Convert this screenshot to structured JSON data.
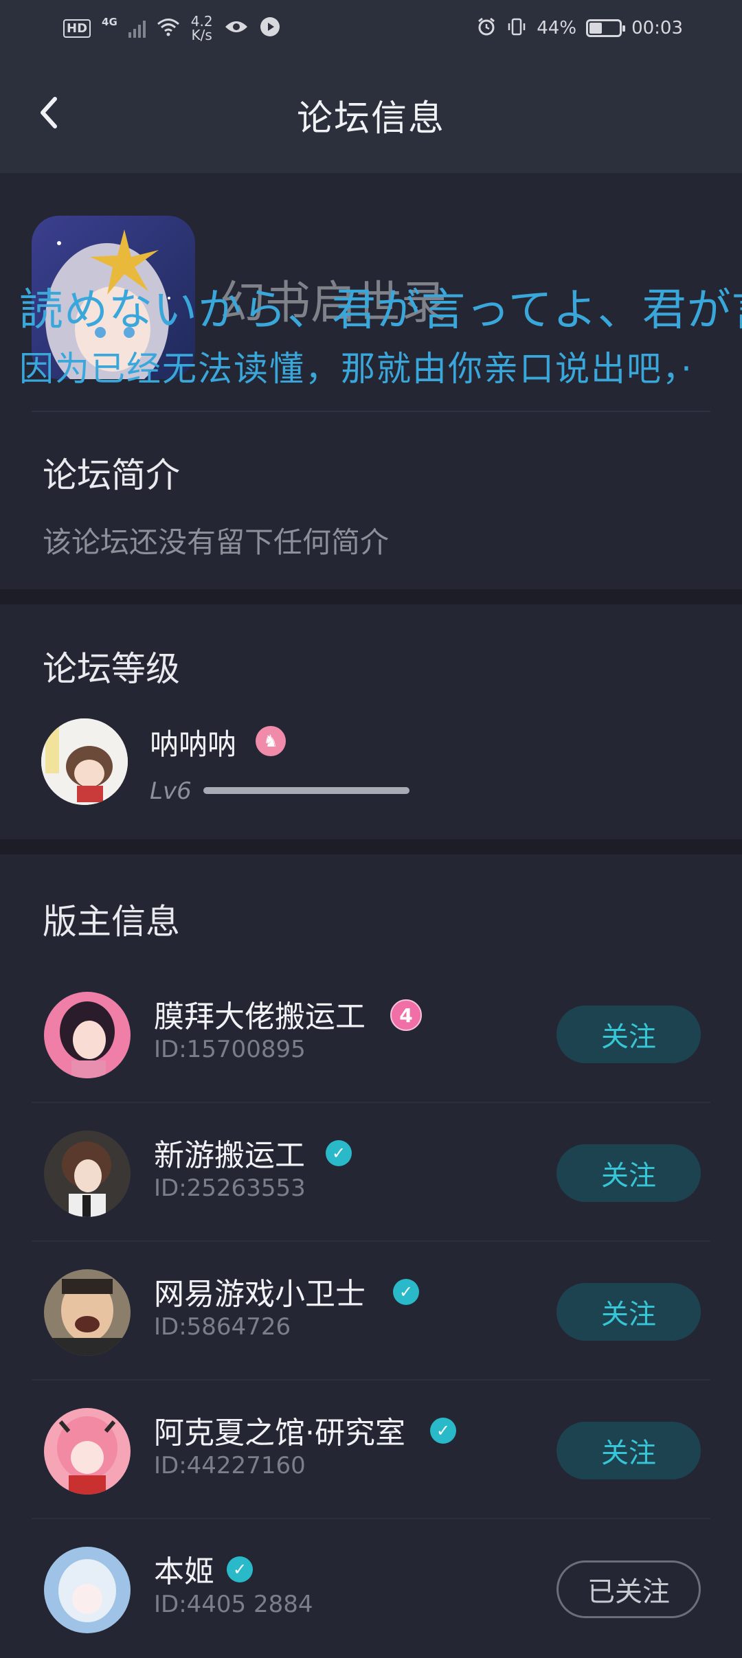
{
  "status_bar": {
    "hd": "HD",
    "network": "4G",
    "speed_value": "4.2",
    "speed_unit": "K/s",
    "battery": "44%",
    "time": "00:03",
    "icons": [
      "signal-icon",
      "wifi-icon",
      "eye-icon",
      "play-icon",
      "alarm-icon",
      "vibrate-icon",
      "battery-icon"
    ]
  },
  "header": {
    "title": "论坛信息",
    "back_icon": "chevron-left-icon"
  },
  "forum": {
    "name": "幻书启世录",
    "lyric_line1": "読めないから、君が言ってよ、君が言",
    "lyric_line2": "因为已经无法读懂，那就由你亲口说出吧，·"
  },
  "intro": {
    "title": "论坛简介",
    "text": "该论坛还没有留下任何简介"
  },
  "level": {
    "title": "论坛等级",
    "user_name": "呐呐呐",
    "level_label": "Lv6",
    "progress": 1.0
  },
  "moderators": {
    "title": "版主信息",
    "list": [
      {
        "name": "膜拜大佬搬运工",
        "id": "ID:15700895",
        "badge": "4",
        "badge_type": "number",
        "button": "关注",
        "followed": false
      },
      {
        "name": "新游搬运工",
        "id": "ID:25263553",
        "badge": "✓",
        "badge_type": "verified",
        "button": "关注",
        "followed": false
      },
      {
        "name": "网易游戏小卫士",
        "id": "ID:5864726",
        "badge": "✓",
        "badge_type": "verified",
        "button": "关注",
        "followed": false
      },
      {
        "name": "阿克夏之馆·研究室",
        "id": "ID:44227160",
        "badge": "✓",
        "badge_type": "verified",
        "button": "关注",
        "followed": false
      },
      {
        "name": "本姬",
        "id": "ID:4405 2884",
        "badge": "✓",
        "badge_type": "verified",
        "button": "已关注",
        "followed": true
      }
    ]
  }
}
